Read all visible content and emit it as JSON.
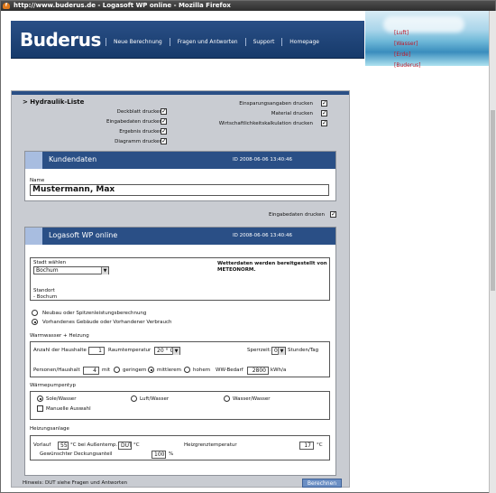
{
  "window": {
    "title": "http://www.buderus.de - Logasoft WP online - Mozilla Firefox"
  },
  "header": {
    "logo": "Buderus",
    "nav": [
      "Neue Berechnung",
      "Fragen und Antworten",
      "Support",
      "Homepage"
    ],
    "side_links": [
      "[Luft]",
      "[Wasser]",
      "[Erde]",
      "[Buderus]"
    ]
  },
  "print_options": {
    "title": "> Hydraulik-Liste",
    "left": [
      {
        "label": "Deckblatt drucken",
        "checked": true
      },
      {
        "label": "Eingabedaten drucken",
        "checked": true
      },
      {
        "label": "Ergebnis drucken",
        "checked": true
      },
      {
        "label": "Diagramm drucken",
        "checked": true
      }
    ],
    "right": [
      {
        "label": "Einsparungsangaben drucken",
        "checked": true
      },
      {
        "label": "Material drucken",
        "checked": true
      },
      {
        "label": "Wirtschaftlichkeitskalkulation drucken",
        "checked": true
      }
    ]
  },
  "kunden": {
    "title": "Kundendaten",
    "id": "ID 2008-06-06 13:40:46",
    "name_label": "Name",
    "name_value": "Mustermann, Max"
  },
  "eingabe_print": {
    "label": "Eingabedaten drucken",
    "checked": true
  },
  "logasoft": {
    "title": "Logasoft WP online",
    "id": "ID 2008-06-06 13:40:46",
    "stadt_label": "Stadt wählen",
    "stadt_value": "Bochum",
    "wetter_line1": "Wetterdaten werden bereitgestellt von",
    "wetter_line2": "METEONORM.",
    "standort_label": "Standort",
    "standort_value": "- Bochum",
    "building_options": [
      {
        "label": "Neubau oder Spitzenleistungsberechnung",
        "selected": false
      },
      {
        "label": "Vorhandenes Gebäude oder Vorhandener Verbrauch",
        "selected": true
      }
    ],
    "ww_title": "Warmwasser + Heizung",
    "haushalte_label": "Anzahl der Haushalte",
    "haushalte_value": "1",
    "raumtemp_label": "Raumtemperatur",
    "raumtemp_value": "20 ° C",
    "sperrzeit_label": "Sperrzeit:",
    "sperrzeit_value": "0",
    "sperrzeit_unit": "Stunden/Tag",
    "personen_label": "Personen/Haushalt",
    "personen_value": "4",
    "mit_label": "mit",
    "consumption_options": [
      {
        "label": "geringem",
        "selected": false
      },
      {
        "label": "mittlerem",
        "selected": true
      },
      {
        "label": "hohem",
        "selected": false
      }
    ],
    "ww_bedarf_label": "WW-Bedarf",
    "ww_bedarf_value": "2800",
    "ww_bedarf_unit": "kWh/a",
    "wp_title": "Wärmepumpentyp",
    "wp_types": [
      {
        "label": "Sole/Wasser",
        "selected": true
      },
      {
        "label": "Luft/Wasser",
        "selected": false
      },
      {
        "label": "Wasser/Wasser",
        "selected": false
      }
    ],
    "manual_label": "Manuelle Auswahl",
    "manual_checked": false,
    "hz_title": "Heizungsanlage",
    "vorlauf_label": "Vorlauf",
    "vorlauf_value": "55",
    "vorlauf_unit": "°C bei Außentemp.",
    "aussen_value": "DUT",
    "aussen_unit": "°C",
    "grenz_label": "Heizgrenztemperatur",
    "grenz_value": "17",
    "grenz_unit": "°C",
    "deckung_label": "Gewünschter Deckungsanteil",
    "deckung_value": "100",
    "deckung_unit": "%"
  },
  "footer": {
    "hint": "Hinweis: DUT siehe Fragen und Antworten",
    "button": "Berechnen"
  }
}
